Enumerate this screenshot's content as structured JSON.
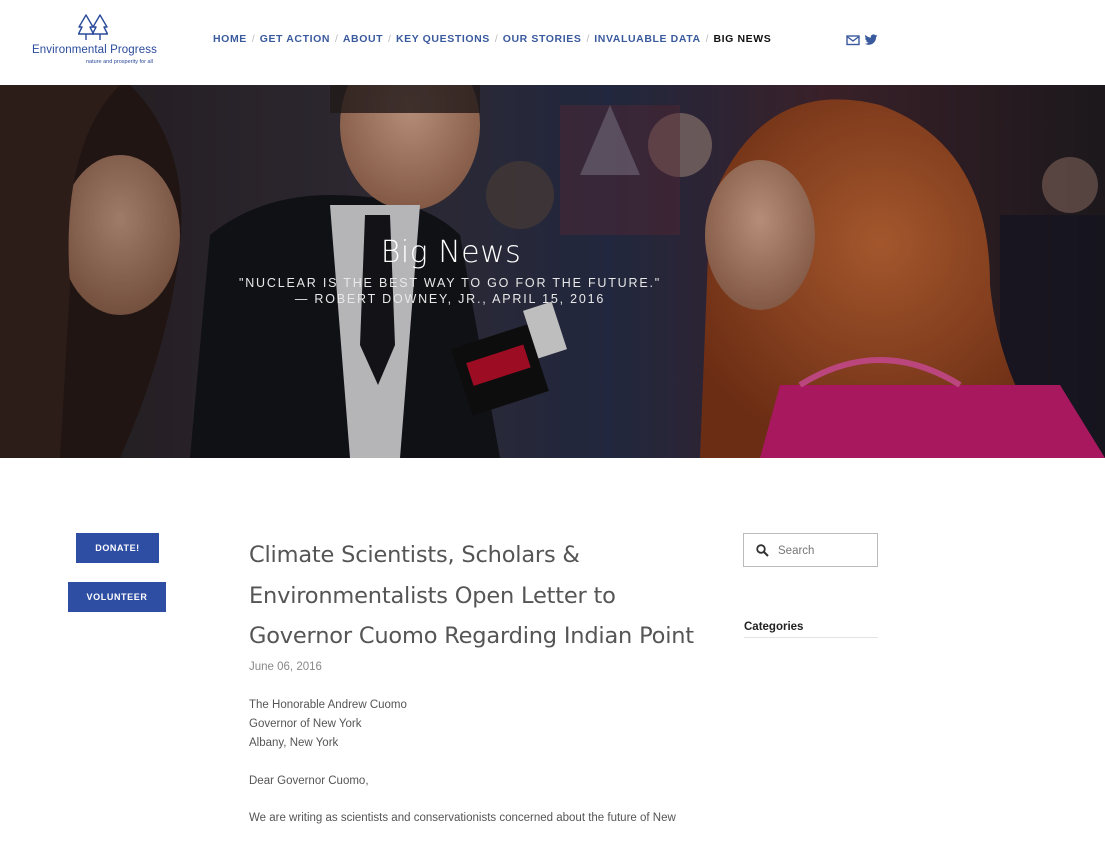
{
  "brand": {
    "name": "Environmental Progress",
    "tagline": "nature and prosperity for all"
  },
  "nav": {
    "items": [
      {
        "label": "HOME"
      },
      {
        "label": "GET ACTION"
      },
      {
        "label": "ABOUT"
      },
      {
        "label": "KEY QUESTIONS"
      },
      {
        "label": "OUR STORIES"
      },
      {
        "label": "INVALUABLE DATA"
      },
      {
        "label": "BIG NEWS",
        "active": true
      }
    ],
    "separator": "/"
  },
  "social": {
    "icons": [
      "mail-icon",
      "twitter-icon"
    ]
  },
  "hero": {
    "title": "Big News",
    "subtitle": "\"Nuclear is the best way to go for the future.\" — Robert Downey, Jr., April 15, 2016"
  },
  "actions": {
    "donate": "DONATE!",
    "volunteer": "VOLUNTEER"
  },
  "article": {
    "title": "Climate Scientists, Scholars & Environmentalists Open Letter to Governor Cuomo Regarding Indian Point",
    "date": "June 06, 2016",
    "address": [
      "The Honorable Andrew Cuomo",
      "Governor of New York",
      "Albany, New York"
    ],
    "salutation": "Dear Governor Cuomo,",
    "body_start": "We are writing as scientists and conservationists concerned about the future of New"
  },
  "sidebar": {
    "search_placeholder": "Search",
    "categories_heading": "Categories"
  },
  "colors": {
    "nav_link": "#3a5a9e",
    "button": "#2e4ea3",
    "brand": "#2a4a9a"
  }
}
